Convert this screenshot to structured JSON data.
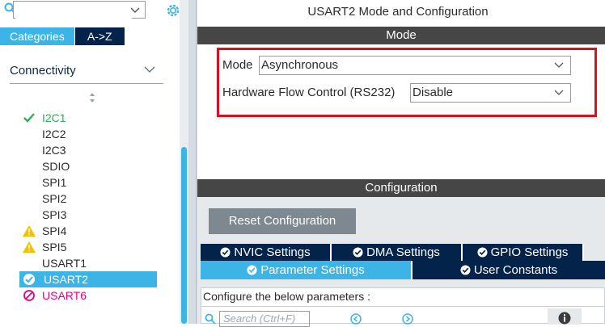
{
  "left_panel": {
    "search": {
      "value": "",
      "placeholder": ""
    },
    "tabs": [
      {
        "label": "Categories",
        "active": true
      },
      {
        "label": "A->Z",
        "active": false
      }
    ],
    "category": {
      "label": "Connectivity"
    },
    "items": [
      {
        "name": "I2C1",
        "status": "ok"
      },
      {
        "name": "I2C2",
        "status": "none"
      },
      {
        "name": "I2C3",
        "status": "none"
      },
      {
        "name": "SDIO",
        "status": "none"
      },
      {
        "name": "SPI1",
        "status": "none"
      },
      {
        "name": "SPI2",
        "status": "none"
      },
      {
        "name": "SPI3",
        "status": "none"
      },
      {
        "name": "SPI4",
        "status": "warning"
      },
      {
        "name": "SPI5",
        "status": "warning"
      },
      {
        "name": "USART1",
        "status": "none"
      },
      {
        "name": "USART2",
        "status": "selected"
      },
      {
        "name": "USART6",
        "status": "error"
      }
    ]
  },
  "right_panel": {
    "title": "USART2 Mode and Configuration",
    "mode_header": "Mode",
    "mode_fields": {
      "mode_label": "Mode",
      "mode_value": "Asynchronous",
      "flow_label": "Hardware Flow Control (RS232)",
      "flow_value": "Disable"
    },
    "config_header": "Configuration",
    "reset_button": "Reset Configuration",
    "tabs_row1": [
      "NVIC Settings",
      "DMA Settings",
      "GPIO Settings"
    ],
    "tabs_row2": [
      "Parameter Settings",
      "User Constants"
    ],
    "params_label": "Configure the below parameters :",
    "params_search_placeholder": "Search (Ctrl+F)"
  },
  "colors": {
    "accent": "#3cb4e6",
    "navy": "#03234b",
    "header_bar": "#464646",
    "highlight_red": "#e20d1b",
    "ok_green": "#2eae55",
    "warn_yellow": "#f5c000",
    "error_pink": "#e6007e"
  }
}
